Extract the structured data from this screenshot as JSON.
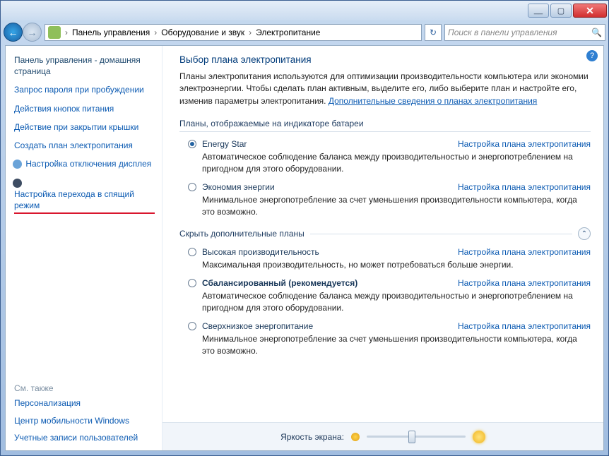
{
  "titlebar": {
    "min": "__",
    "max": "▢",
    "close": "✕"
  },
  "nav": {
    "crumb1": "Панель управления",
    "crumb2": "Оборудование и звук",
    "crumb3": "Электропитание",
    "sep": "›",
    "refresh": "↻",
    "search_placeholder": "Поиск в панели управления",
    "mag": "🔍"
  },
  "sidebar": {
    "home": "Панель управления - домашняя страница",
    "items": [
      "Запрос пароля при пробуждении",
      "Действия кнопок питания",
      "Действие при закрытии крышки",
      "Создать план электропитания",
      "Настройка отключения дисплея",
      "Настройка перехода в спящий режим"
    ],
    "see_also": "См. также",
    "bottom": [
      "Персонализация",
      "Центр мобильности Windows",
      "Учетные записи пользователей"
    ]
  },
  "main": {
    "help": "?",
    "title": "Выбор плана электропитания",
    "intro": "Планы электропитания используются для оптимизации производительности компьютера или экономии электроэнергии. Чтобы сделать план активным, выделите его, либо выберите план и настройте его, изменив параметры электропитания. ",
    "intro_link": "Дополнительные сведения о планах электропитания",
    "section1": "Планы, отображаемые на индикаторе батареи",
    "plan_link_label": "Настройка плана электропитания",
    "plans_top": [
      {
        "name": "Energy Star",
        "selected": true,
        "bold": false,
        "desc": "Автоматическое соблюдение баланса между производительностью и энергопотреблением на пригодном для этого оборудовании."
      },
      {
        "name": "Экономия энергии",
        "selected": false,
        "bold": false,
        "desc": "Минимальное энергопотребление за счет уменьшения производительности компьютера, когда это возможно."
      }
    ],
    "collapse_label": "Скрыть дополнительные планы",
    "collapse_glyph": "⌃",
    "plans_extra": [
      {
        "name": "Высокая производительность",
        "selected": false,
        "bold": false,
        "desc": "Максимальная производительность, но может потребоваться больше энергии."
      },
      {
        "name": "Сбалансированный (рекомендуется)",
        "selected": false,
        "bold": true,
        "desc": "Автоматическое соблюдение баланса между производительностью и энергопотреблением на пригодном для этого оборудовании."
      },
      {
        "name": "Сверхнизкое энергопитание",
        "selected": false,
        "bold": false,
        "desc": "Минимальное энергопотребление за счет уменьшения производительности компьютера, когда это возможно."
      }
    ],
    "brightness_label": "Яркость экрана:"
  }
}
